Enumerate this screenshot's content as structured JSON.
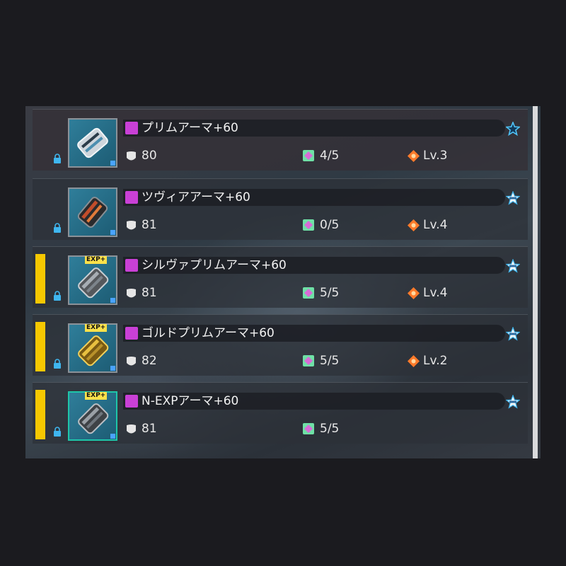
{
  "items": [
    {
      "name": "プリムアーマ+60",
      "defense": "80",
      "slots": "4/5",
      "level": "Lv.3",
      "selected": false,
      "exp_tag": "",
      "star_icon": "star-outline-icon"
    },
    {
      "name": "ツヴィアアーマ+60",
      "defense": "81",
      "slots": "0/5",
      "level": "Lv.4",
      "selected": false,
      "exp_tag": "",
      "star_icon": "star-badge-icon"
    },
    {
      "name": "シルヴァプリムアーマ+60",
      "defense": "81",
      "slots": "5/5",
      "level": "Lv.4",
      "selected": true,
      "exp_tag": "EXP+",
      "star_icon": "star-badge-icon"
    },
    {
      "name": "ゴルドプリムアーマ+60",
      "defense": "82",
      "slots": "5/5",
      "level": "Lv.2",
      "selected": true,
      "exp_tag": "EXP+",
      "star_icon": "star-badge-icon"
    },
    {
      "name": "N-EXPアーマ+60",
      "defense": "81",
      "slots": "5/5",
      "level": "",
      "selected": true,
      "exp_tag": "EXP+",
      "star_icon": "star-badge-icon"
    }
  ],
  "colors": {
    "selection_bar": "#f6c800",
    "name_tag": "#c940d6",
    "accent_blue": "#3fb6ef"
  }
}
